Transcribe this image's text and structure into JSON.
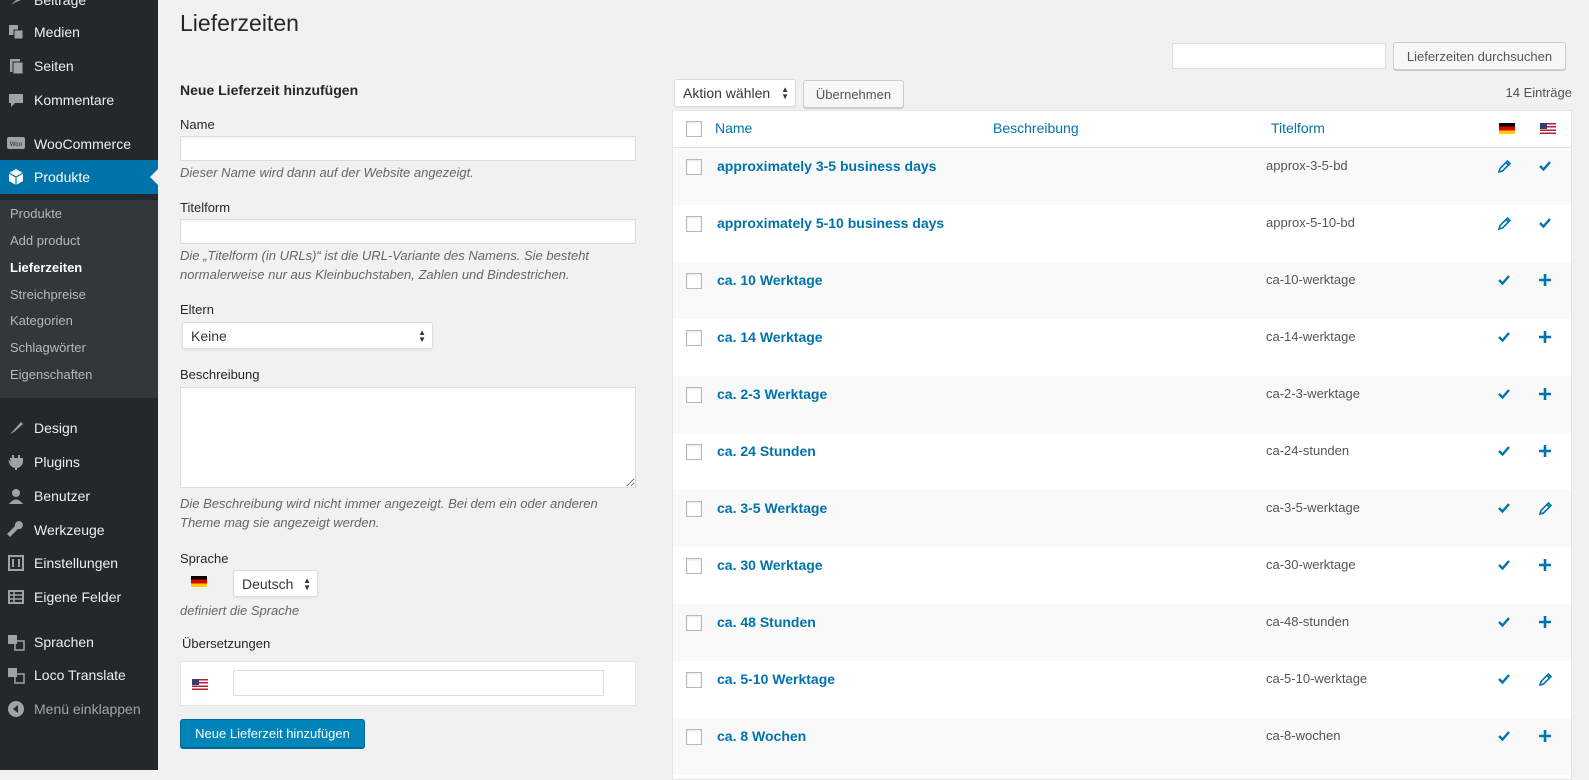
{
  "sidebar": {
    "items": [
      {
        "label": "Beiträge",
        "icon": "pin-icon"
      },
      {
        "label": "Medien",
        "icon": "media-icon"
      },
      {
        "label": "Seiten",
        "icon": "pages-icon"
      },
      {
        "label": "Kommentare",
        "icon": "comments-icon"
      },
      {
        "label": "WooCommerce",
        "icon": "woocommerce-icon"
      },
      {
        "label": "Produkte",
        "icon": "products-icon"
      },
      {
        "label": "Design",
        "icon": "appearance-icon"
      },
      {
        "label": "Plugins",
        "icon": "plugins-icon"
      },
      {
        "label": "Benutzer",
        "icon": "users-icon"
      },
      {
        "label": "Werkzeuge",
        "icon": "tools-icon"
      },
      {
        "label": "Einstellungen",
        "icon": "settings-icon"
      },
      {
        "label": "Eigene Felder",
        "icon": "custom-fields-icon"
      },
      {
        "label": "Sprachen",
        "icon": "languages-icon"
      },
      {
        "label": "Loco Translate",
        "icon": "translate-icon"
      },
      {
        "label": "Menü einklappen",
        "icon": "collapse-icon"
      }
    ],
    "submenu": [
      "Produkte",
      "Add product",
      "Lieferzeiten",
      "Streichpreise",
      "Kategorien",
      "Schlagwörter",
      "Eigenschaften"
    ],
    "active_color": "#0073aa"
  },
  "page": {
    "title": "Lieferzeiten",
    "search_button": "Lieferzeiten durchsuchen"
  },
  "form": {
    "heading": "Neue Lieferzeit hinzufügen",
    "name_label": "Name",
    "name_help": "Dieser Name wird dann auf der Website angezeigt.",
    "slug_label": "Titelform",
    "slug_help": "Die „Titelform (in URLs)“ ist die URL-Variante des Namens. Sie besteht normalerweise nur aus Kleinbuchstaben, Zahlen und Bindestrichen.",
    "parent_label": "Eltern",
    "parent_value": "Keine",
    "description_label": "Beschreibung",
    "description_help": "Die Beschreibung wird nicht immer angezeigt. Bei dem ein oder anderen Theme mag sie angezeigt werden.",
    "language_label": "Sprache",
    "language_value": "Deutsch",
    "language_help": "definiert die Sprache",
    "translations_label": "Übersetzungen",
    "submit": "Neue Lieferzeit hinzufügen"
  },
  "table": {
    "bulk_action": "Aktion wählen",
    "apply": "Übernehmen",
    "count": "14 Einträge",
    "columns": {
      "name": "Name",
      "description": "Beschreibung",
      "slug": "Titelform"
    },
    "rows": [
      {
        "name": "approximately 3-5 business days",
        "slug": "approx-3-5-bd",
        "de": "edit",
        "us": "check"
      },
      {
        "name": "approximately 5-10 business days",
        "slug": "approx-5-10-bd",
        "de": "edit",
        "us": "check"
      },
      {
        "name": "ca. 10 Werktage",
        "slug": "ca-10-werktage",
        "de": "check",
        "us": "plus"
      },
      {
        "name": "ca. 14 Werktage",
        "slug": "ca-14-werktage",
        "de": "check",
        "us": "plus"
      },
      {
        "name": "ca. 2-3 Werktage",
        "slug": "ca-2-3-werktage",
        "de": "check",
        "us": "plus"
      },
      {
        "name": "ca. 24 Stunden",
        "slug": "ca-24-stunden",
        "de": "check",
        "us": "plus"
      },
      {
        "name": "ca. 3-5 Werktage",
        "slug": "ca-3-5-werktage",
        "de": "check",
        "us": "edit"
      },
      {
        "name": "ca. 30 Werktage",
        "slug": "ca-30-werktage",
        "de": "check",
        "us": "plus"
      },
      {
        "name": "ca. 48 Stunden",
        "slug": "ca-48-stunden",
        "de": "check",
        "us": "plus"
      },
      {
        "name": "ca. 5-10 Werktage",
        "slug": "ca-5-10-werktage",
        "de": "check",
        "us": "edit"
      },
      {
        "name": "ca. 8 Wochen",
        "slug": "ca-8-wochen",
        "de": "check",
        "us": "plus"
      }
    ]
  }
}
